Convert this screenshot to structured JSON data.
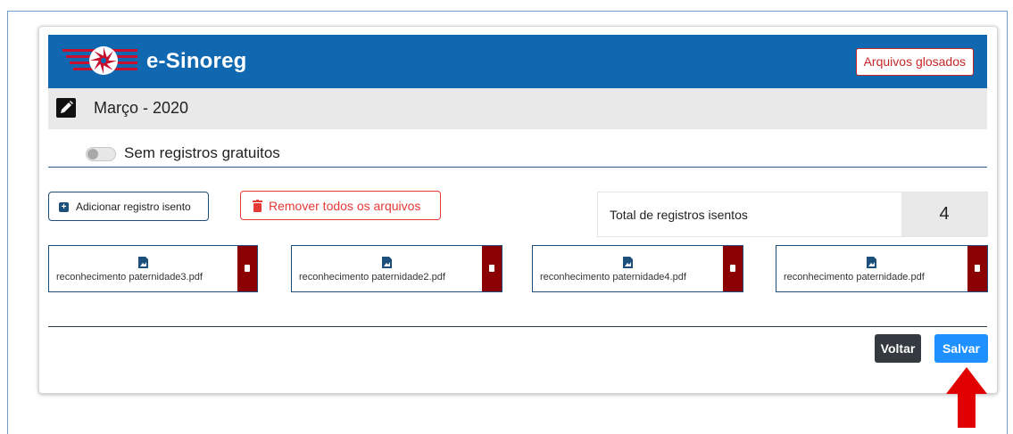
{
  "header": {
    "brand": "e-Sinoreg",
    "glosados_button": "Arquivos glosados"
  },
  "month": {
    "title": "Março - 2020"
  },
  "toggle": {
    "label": "Sem registros gratuitos",
    "on": false
  },
  "actions": {
    "add_label": "Adicionar registro isento",
    "remove_label": "Remover todos os arquivos"
  },
  "total": {
    "label": "Total de registros isentos",
    "value": "4"
  },
  "files": [
    {
      "name": "reconhecimento paternidade3.pdf"
    },
    {
      "name": "reconhecimento paternidade2.pdf"
    },
    {
      "name": "reconhecimento paternidade4.pdf"
    },
    {
      "name": "reconhecimento paternidade.pdf"
    }
  ],
  "footer": {
    "voltar": "Voltar",
    "salvar": "Salvar"
  },
  "colors": {
    "header_blue": "#1068b0",
    "danger": "#8b0000",
    "primary": "#1e90ff",
    "arrow": "#e00000"
  }
}
